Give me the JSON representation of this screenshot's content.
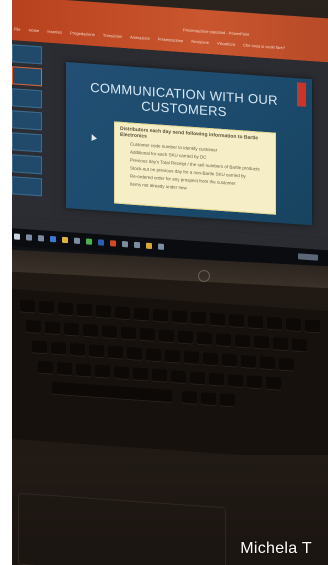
{
  "app": {
    "window_title": "Presentazione standard - PowerPoint",
    "ribbon_tabs": [
      "File",
      "Home",
      "Inserisci",
      "Progettazione",
      "Transizioni",
      "Animazioni",
      "Presentazione",
      "Revisione",
      "Visualizza",
      "Che cosa si vuole fare?"
    ]
  },
  "slide": {
    "title": "COMMUNICATION WITH OUR CUSTOMERS",
    "note_heading": "Distributors each day send following information to Bartle Electronics",
    "note_items": [
      "Customer code number to identify customer",
      "Additional for each SKU carried by DC",
      "Previous day's Total Receipt / the sell numbers of Bartle products",
      "Stock-out on previous day for a non-Bartle SKU carried by",
      "Re-ordered order for any prospect from the customer",
      "Items not already under new"
    ]
  },
  "colors": {
    "ribbon": "#c24e27",
    "slide_background": "#1f4b6f",
    "slide_title": "#d9e9f5",
    "note_background": "#f5eec7",
    "accent": "#c8362a"
  },
  "watermark": "Michela T"
}
